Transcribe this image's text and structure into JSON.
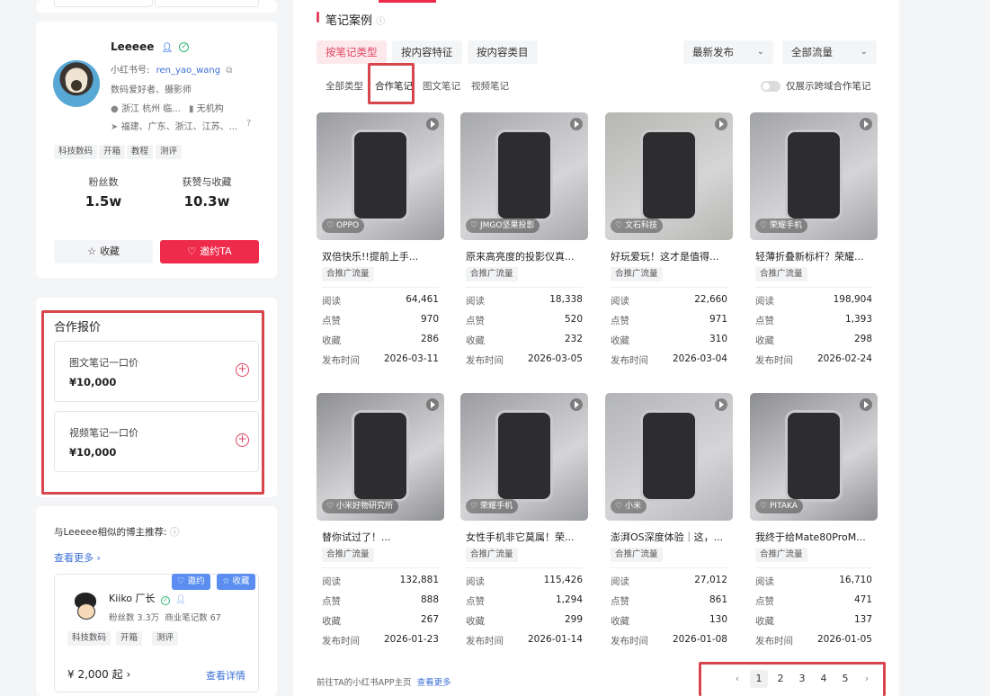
{
  "profile": {
    "name": "Leeeee",
    "id_label": "小红书号:",
    "id_value": "ren_yao_wang",
    "bio": "数码爱好者、摄影师",
    "location": "浙江 杭州 临...",
    "org": "无机构",
    "regions": "福建、广东、浙江、江苏、...",
    "tags": [
      "科技数码",
      "开箱",
      "教程",
      "测评"
    ],
    "fans_label": "粉丝数",
    "fans_value": "1.5w",
    "likes_label": "获赞与收藏",
    "likes_value": "10.3w",
    "fav_label": "收藏",
    "invite_label": "邀约TA"
  },
  "price": {
    "title": "合作报价",
    "items": [
      {
        "label": "图文笔记一口价",
        "value": "¥10,000"
      },
      {
        "label": "视频笔记一口价",
        "value": "¥10,000"
      }
    ]
  },
  "similar": {
    "title": "与Leeeee相似的博主推荐:",
    "more": "查看更多",
    "card": {
      "name": "Kiiko 厂长",
      "invite": "邀约",
      "collect": "收藏",
      "fans": "粉丝数 3.3万",
      "notes": "商业笔记数 67",
      "tags": [
        "科技数码",
        "开箱",
        "测评"
      ],
      "price": "¥ 2,000 起",
      "detail": "查看详情"
    }
  },
  "notes": {
    "title": "笔记案例",
    "filters": [
      "按笔记类型",
      "按内容特征",
      "按内容类目"
    ],
    "sort": "最新发布",
    "traffic": "全部流量",
    "subtabs": [
      "全部类型",
      "合作笔记",
      "图文笔记",
      "视频笔记"
    ],
    "cross_label": "仅展示跨域合作笔记",
    "row_labels": [
      "阅读",
      "点赞",
      "收藏",
      "发布时间"
    ],
    "cards": [
      {
        "brand": "OPPO",
        "title": "双倍快乐!!提前上手...",
        "tag": "合推广流量",
        "read": "64,461",
        "like": "970",
        "fav": "286",
        "date": "2026-03-11",
        "bg": "#9a9b9f"
      },
      {
        "brand": "JMGO坚果投影",
        "title": "原来高亮度的投影仪真...",
        "tag": "合推广流量",
        "read": "18,338",
        "like": "520",
        "fav": "232",
        "date": "2026-03-05",
        "bg": "#a7a8ab"
      },
      {
        "brand": "文石科技",
        "title": "好玩爱玩！这才是值得...",
        "tag": "合推广流量",
        "read": "22,660",
        "like": "971",
        "fav": "310",
        "date": "2026-03-04",
        "bg": "#b7b6b1"
      },
      {
        "brand": "荣耀手机",
        "title": "轻薄折叠新标杆？荣耀...",
        "tag": "合推广流量",
        "read": "198,904",
        "like": "1,393",
        "fav": "298",
        "date": "2026-02-24",
        "bg": "#a2a3a6"
      },
      {
        "brand": "小米好物研究所",
        "title": "替你试过了！...",
        "tag": "合推广流量",
        "read": "132,881",
        "like": "888",
        "fav": "267",
        "date": "2026-01-23",
        "bg": "#8e8f92"
      },
      {
        "brand": "荣耀手机",
        "title": "女性手机非它莫属！荣...",
        "tag": "合推广流量",
        "read": "115,426",
        "like": "1,294",
        "fav": "299",
        "date": "2026-01-14",
        "bg": "#9b9ca0"
      },
      {
        "brand": "小米",
        "title": "澎湃OS深度体验｜这，...",
        "tag": "合推广流量",
        "read": "27,012",
        "like": "861",
        "fav": "130",
        "date": "2026-01-08",
        "bg": "#b3b4b8"
      },
      {
        "brand": "PITAKA",
        "title": "我终于给Mate80ProM...",
        "tag": "合推广流量",
        "read": "16,710",
        "like": "471",
        "fav": "137",
        "date": "2026-01-05",
        "bg": "#8d8e92"
      }
    ],
    "footer": "前往TA的小红书APP主页",
    "footer_link": "查看更多",
    "pages": [
      "1",
      "2",
      "3",
      "4",
      "5"
    ]
  }
}
